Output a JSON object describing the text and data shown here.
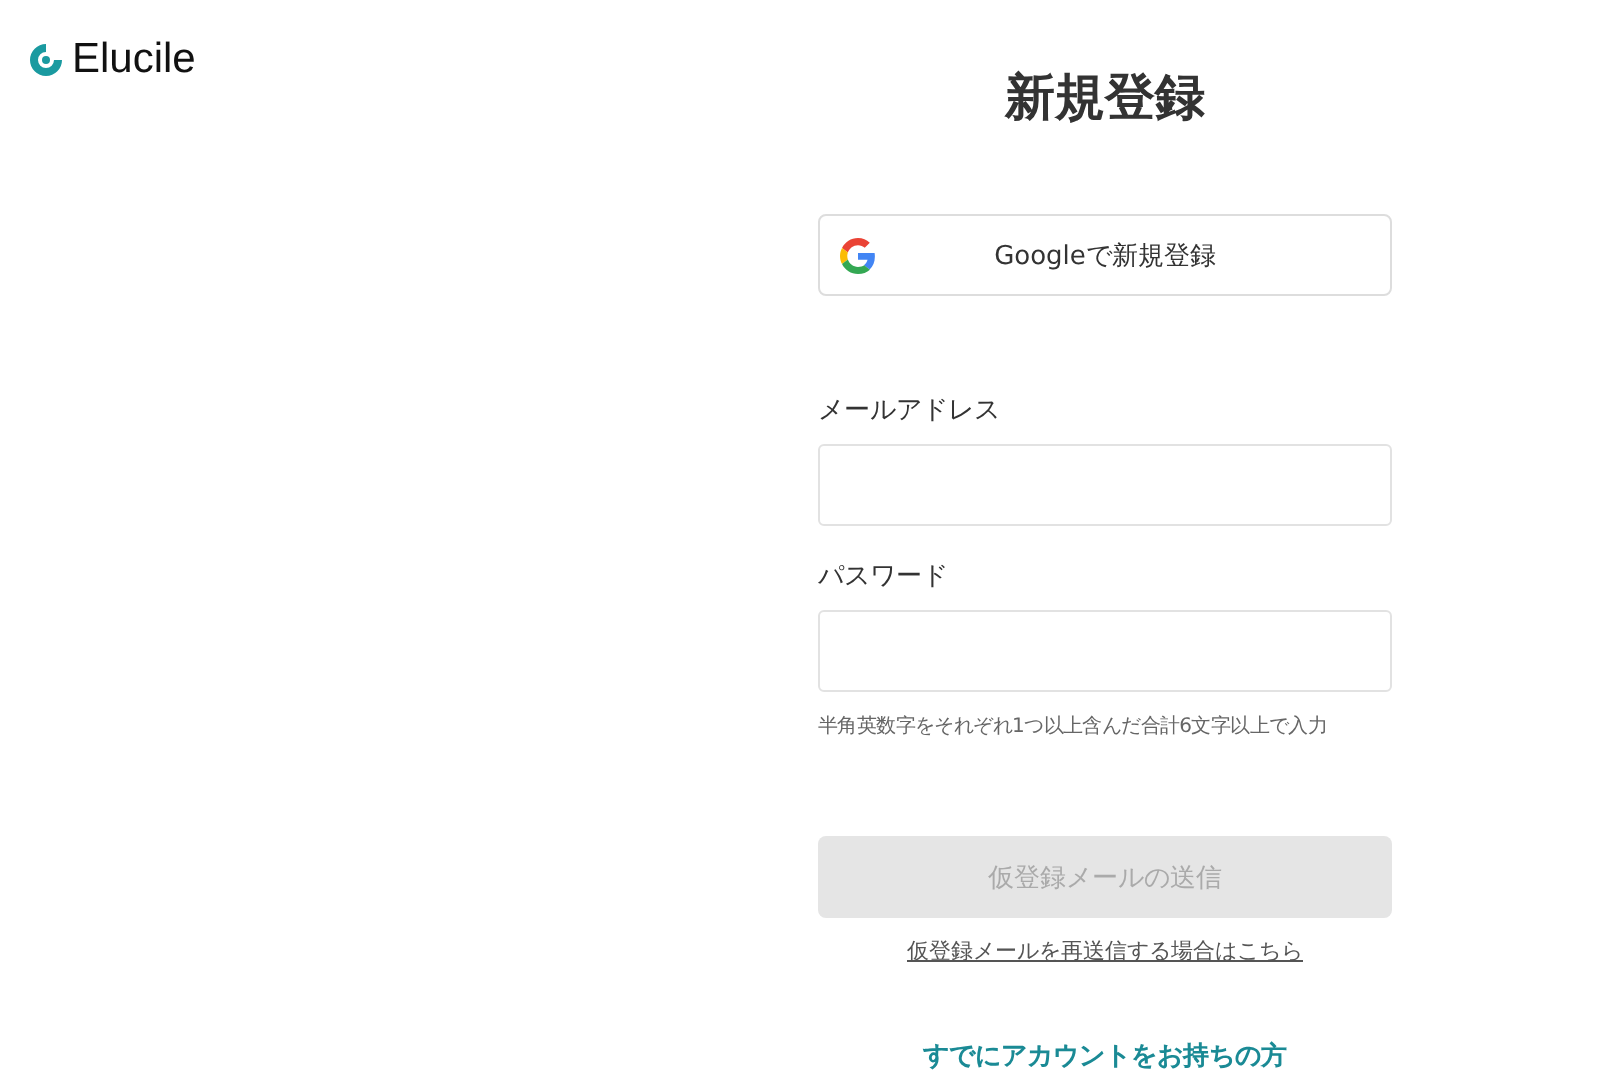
{
  "logo": {
    "text": "Elucile"
  },
  "title": "新規登録",
  "google_button": {
    "label": "Googleで新規登録"
  },
  "fields": [
    {
      "label": "メールアドレス"
    },
    {
      "label": "パスワード",
      "hint": "半角英数字をそれぞれ1つ以上含んだ合計6文字以上で入力"
    }
  ],
  "submit_button": {
    "label": "仮登録メールの送信",
    "disabled": true
  },
  "resend_link": "仮登録メールを再送信する場合はこちら",
  "login_link": "すでにアカウントをお持ちの方"
}
